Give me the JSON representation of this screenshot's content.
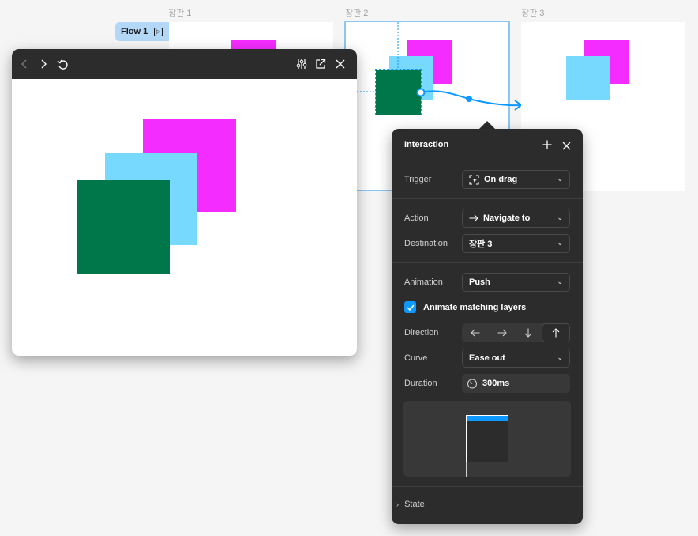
{
  "canvas": {
    "background": "#f5f5f5",
    "frames": [
      {
        "label": "장판 1"
      },
      {
        "label": "장판 2"
      },
      {
        "label": "장판 3"
      }
    ],
    "flow": {
      "label": "Flow 1",
      "icon": "play-icon"
    },
    "colors": {
      "magenta": "#f52cff",
      "light_blue": "#76d9fd",
      "green": "#00774a",
      "selection": "#0d99ff"
    }
  },
  "preview": {
    "toolbar": {
      "back_icon": "chevron-left-icon",
      "forward_icon": "chevron-right-icon",
      "restart_icon": "restart-icon",
      "settings_icon": "sliders-icon",
      "open_icon": "open-external-icon",
      "close_icon": "close-icon"
    }
  },
  "interaction_panel": {
    "title": "Interaction",
    "add_icon": "plus-icon",
    "close_icon": "close-icon",
    "trigger": {
      "label": "Trigger",
      "value": "On drag",
      "icon": "drag-icon"
    },
    "action": {
      "label": "Action",
      "value": "Navigate to",
      "icon": "arrow-right-icon"
    },
    "destination": {
      "label": "Destination",
      "value": "장판 3"
    },
    "animation": {
      "label": "Animation",
      "value": "Push"
    },
    "animate_matching": {
      "label": "Animate matching layers",
      "checked": true
    },
    "direction": {
      "label": "Direction",
      "options": [
        "left",
        "right",
        "down",
        "up"
      ],
      "selected": "up"
    },
    "curve": {
      "label": "Curve",
      "value": "Ease out"
    },
    "duration": {
      "label": "Duration",
      "value": "300ms",
      "icon": "timer-icon"
    },
    "state": {
      "label": "State"
    }
  }
}
